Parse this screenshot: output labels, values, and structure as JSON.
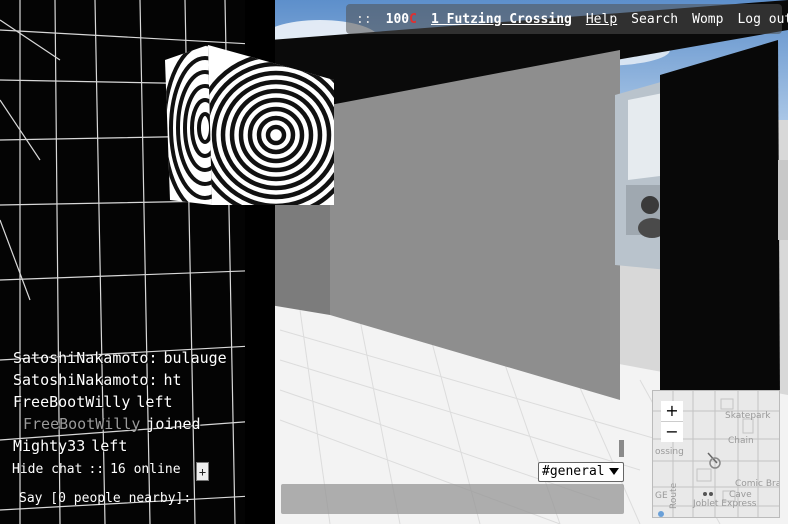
{
  "topbar": {
    "separator": "::",
    "money_amount": "100",
    "money_currency": "C",
    "location": "1 Futzing Crossing",
    "menu": {
      "help": "Help",
      "search": "Search",
      "womp": "Womp",
      "logout": "Log out"
    }
  },
  "chat": {
    "messages": [
      {
        "name": "SatoshiNakamoto:",
        "text": "bulauge"
      },
      {
        "name": "SatoshiNakamoto:",
        "text": "ht"
      }
    ],
    "events": [
      {
        "name": "FreeBootWilly",
        "text": "left"
      },
      {
        "name": "FreeBootWilly",
        "text": "joined"
      },
      {
        "name": "Mighty33",
        "text": "left"
      }
    ],
    "hide_chat_label": "Hide chat",
    "separator": "::",
    "online_label": "16 online",
    "plus_label": "+",
    "channel": "#general",
    "say_label": "Say [0 people nearby]:"
  },
  "minimap": {
    "zoom_in": "+",
    "zoom_out": "−",
    "labels": {
      "skatepark": "Skatepark",
      "chain": "Chain",
      "crossing": "ossing",
      "comic": "Comic Bra",
      "cave": "Cave",
      "joblet": "Joblet Express",
      "route": "Route",
      "ge": "GE"
    }
  },
  "colors": {
    "sky": "#6f9fd0",
    "wall_gray": "#8c8c8c",
    "floor": "#f2f2f2",
    "black_wall": "#050505",
    "currency_red": "#e03030"
  }
}
